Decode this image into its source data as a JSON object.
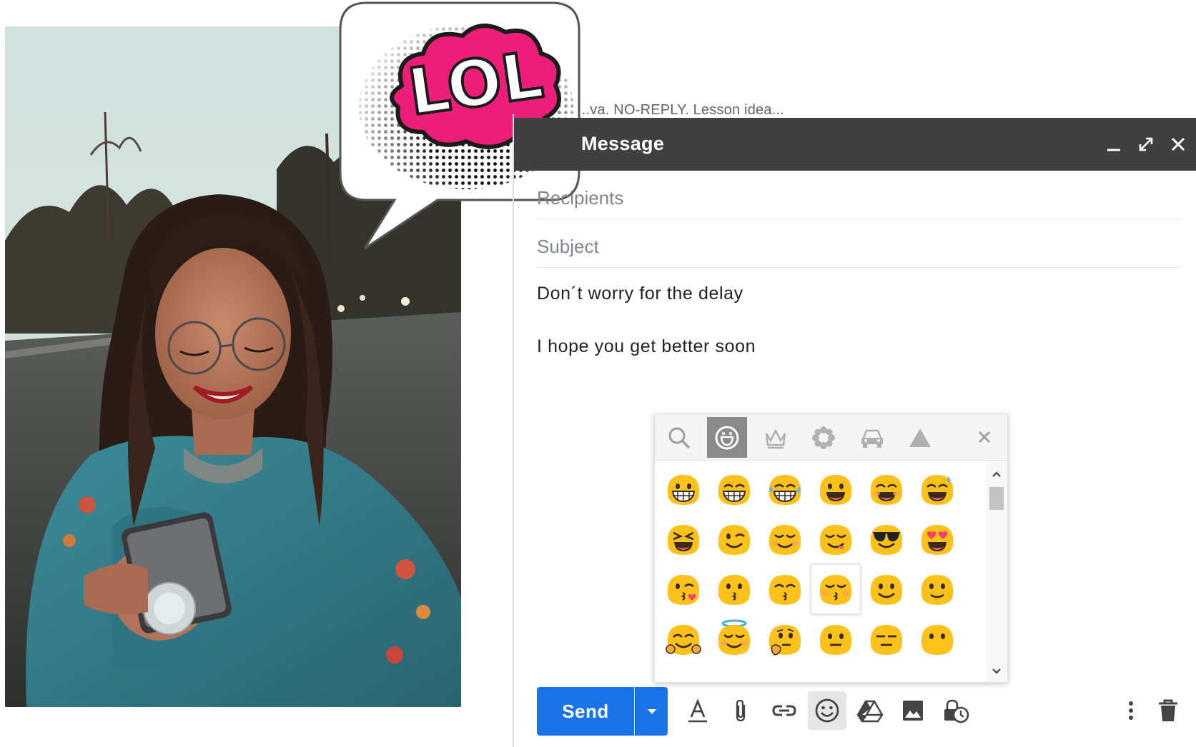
{
  "sticker": {
    "text": "LOL",
    "color": "#ed1e79"
  },
  "compose": {
    "ghost_recipients": "...va, NO-REPLY, Lesson idea...",
    "title": "Message",
    "recipients_placeholder": "Recipients",
    "subject_placeholder": "Subject",
    "body_lines": [
      "Don´t worry for the delay",
      "I hope you get better soon"
    ],
    "header_color": "#404040"
  },
  "emoji_picker": {
    "tabs": [
      {
        "icon": "search-icon",
        "active": false
      },
      {
        "icon": "smiley-icon",
        "active": true
      },
      {
        "icon": "crown-icon",
        "active": false
      },
      {
        "icon": "flower-icon",
        "active": false
      },
      {
        "icon": "car-icon",
        "active": false
      },
      {
        "icon": "triangle-icon",
        "active": false
      }
    ],
    "close_icon": "close-icon",
    "selected_emoji_index": 15,
    "emojis": [
      "grinning",
      "grin",
      "joy",
      "smiley",
      "smile",
      "sweat-smile",
      "laughing",
      "wink",
      "blush",
      "yum",
      "sunglasses",
      "heart-eyes",
      "kissing-heart",
      "kissing",
      "kissing-smiling-eyes",
      "kissing-closed-eyes",
      "slightly-smiling",
      "smiling",
      "hugging",
      "innocent",
      "thinking",
      "neutral",
      "expressionless",
      "no-mouth"
    ]
  },
  "toolbar": {
    "send_label": "Send",
    "accent": "#1a73e8",
    "tools": [
      "formatting-icon",
      "attach-icon",
      "link-icon",
      "emoji-icon",
      "drive-icon",
      "photo-icon",
      "confidential-icon"
    ],
    "active_tool": "emoji-icon"
  }
}
